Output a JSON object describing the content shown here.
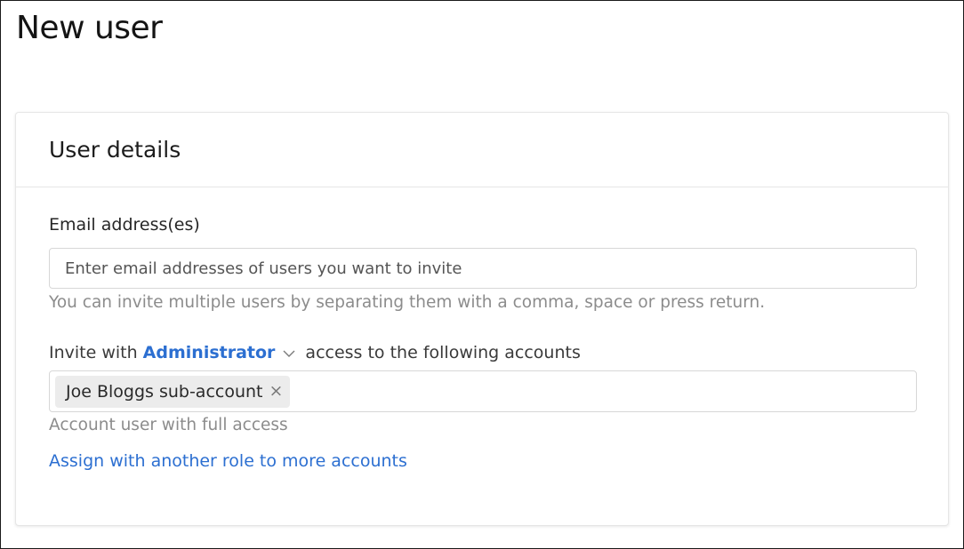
{
  "page": {
    "title": "New user"
  },
  "card": {
    "title": "User details",
    "email": {
      "label": "Email address(es)",
      "value": "",
      "placeholder": "Enter email addresses of users you want to invite",
      "help": "You can invite multiple users by separating them with a comma, space or press return."
    },
    "invite": {
      "prefix": "Invite with",
      "role": "Administrator",
      "suffix": "access to the following accounts",
      "accounts": [
        {
          "label": "Joe Bloggs sub-account",
          "remove": "×"
        }
      ],
      "role_help": "Account user with full access",
      "assign_link": "Assign with another role to more accounts"
    }
  },
  "icons": {
    "role_dropdown": "chevron-down-icon",
    "chip_remove": "close-icon"
  },
  "colors": {
    "link": "#2c6fd1",
    "help_text": "#8c8c8c",
    "chip_bg": "#ececec"
  }
}
